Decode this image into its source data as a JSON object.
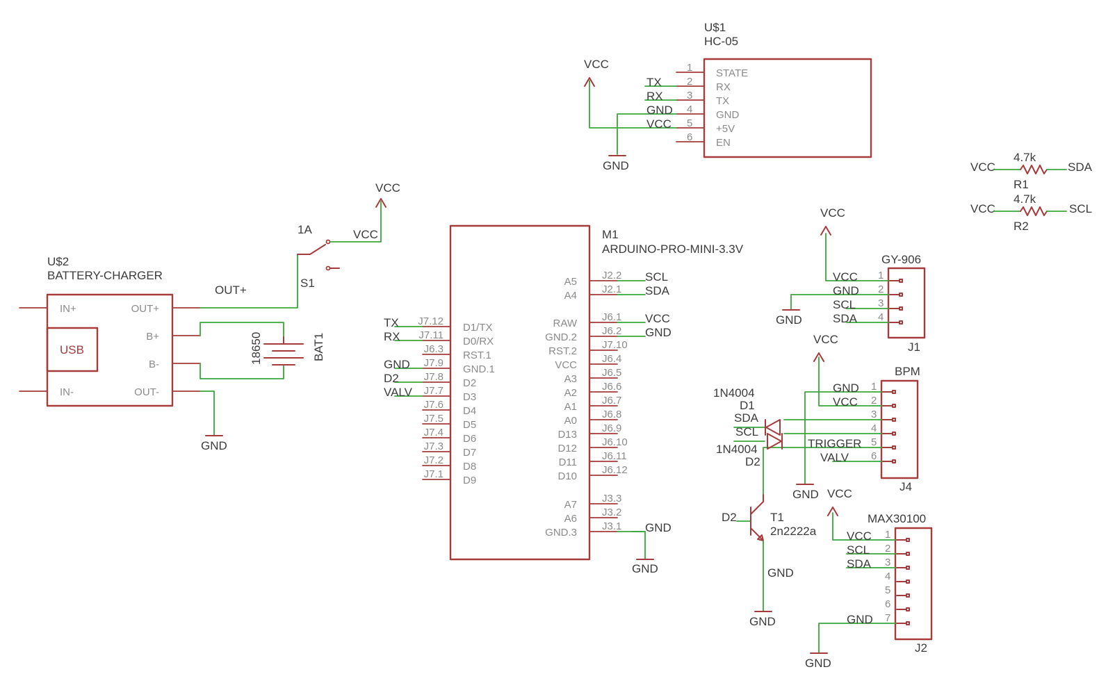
{
  "hc05": {
    "name": "U$1",
    "value": "HC-05",
    "pin_numbers": [
      "1",
      "2",
      "3",
      "4",
      "5",
      "6"
    ],
    "pin_names": [
      "STATE",
      "RX",
      "TX",
      "GND",
      "+5V",
      "EN"
    ],
    "nets": [
      "TX",
      "RX",
      "GND",
      "VCC"
    ],
    "supply_vcc": "VCC",
    "gnd": "GND"
  },
  "charger": {
    "name": "U$2",
    "value": "BATTERY-CHARGER",
    "pins": [
      "IN+",
      "IN-",
      "OUT+",
      "B+",
      "B-",
      "OUT-"
    ],
    "usb_label": "USB",
    "out_net": "OUT+",
    "gnd": "GND"
  },
  "battery": {
    "name": "BAT1",
    "value": "18650"
  },
  "switch": {
    "name": "S1",
    "value": "1A",
    "net": "VCC",
    "supply": "VCC"
  },
  "arduino": {
    "name": "M1",
    "value": "ARDUINO-PRO-MINI-3.3V",
    "left_pins": [
      {
        "pad": "J7.12",
        "name": "D1/TX",
        "net": "TX"
      },
      {
        "pad": "J7.11",
        "name": "D0/RX",
        "net": "RX"
      },
      {
        "pad": "J6.3",
        "name": "RST.1",
        "net": ""
      },
      {
        "pad": "J7.9",
        "name": "GND.1",
        "net": "GND"
      },
      {
        "pad": "J7.8",
        "name": "D2",
        "net": "D2"
      },
      {
        "pad": "J7.7",
        "name": "D3",
        "net": "VALV"
      },
      {
        "pad": "J7.6",
        "name": "D4",
        "net": ""
      },
      {
        "pad": "J7.5",
        "name": "D5",
        "net": ""
      },
      {
        "pad": "J7.4",
        "name": "D6",
        "net": ""
      },
      {
        "pad": "J7.3",
        "name": "D7",
        "net": ""
      },
      {
        "pad": "J7.2",
        "name": "D8",
        "net": ""
      },
      {
        "pad": "J7.1",
        "name": "D9",
        "net": ""
      }
    ],
    "right_pins_top": [
      {
        "pad": "J2.2",
        "name": "A5",
        "net": "SCL"
      },
      {
        "pad": "J2.1",
        "name": "A4",
        "net": "SDA"
      }
    ],
    "right_pins_mid": [
      {
        "pad": "J6.1",
        "name": "RAW",
        "net": "VCC"
      },
      {
        "pad": "J6.2",
        "name": "GND.2",
        "net": "GND"
      },
      {
        "pad": "J7.10",
        "name": "RST.2",
        "net": ""
      },
      {
        "pad": "J6.4",
        "name": "VCC",
        "net": ""
      },
      {
        "pad": "J6.5",
        "name": "A3",
        "net": ""
      },
      {
        "pad": "J6.6",
        "name": "A2",
        "net": ""
      },
      {
        "pad": "J6.7",
        "name": "A1",
        "net": ""
      },
      {
        "pad": "J6.8",
        "name": "A0",
        "net": ""
      },
      {
        "pad": "J6.9",
        "name": "D13",
        "net": ""
      },
      {
        "pad": "J6.10",
        "name": "D12",
        "net": ""
      },
      {
        "pad": "J6.11",
        "name": "D11",
        "net": ""
      },
      {
        "pad": "J6.12",
        "name": "D10",
        "net": ""
      }
    ],
    "right_pins_bottom": [
      {
        "pad": "J3.3",
        "name": "A7",
        "net": ""
      },
      {
        "pad": "J3.2",
        "name": "A6",
        "net": ""
      },
      {
        "pad": "J3.1",
        "name": "GND.3",
        "net": "GND"
      }
    ],
    "gnd": "GND"
  },
  "resistors": [
    {
      "name": "R1",
      "value": "4.7k",
      "left": "VCC",
      "right": "SDA"
    },
    {
      "name": "R2",
      "value": "4.7k",
      "left": "VCC",
      "right": "SCL"
    }
  ],
  "gy906": {
    "value": "GY-906",
    "name": "J1",
    "pin_numbers": [
      "1",
      "2",
      "3",
      "4"
    ],
    "nets": [
      "VCC",
      "GND",
      "SCL",
      "SDA"
    ],
    "supply": "VCC",
    "gnd": "GND"
  },
  "bpm": {
    "value": "BPM",
    "name": "J4",
    "pin_numbers": [
      "1",
      "2",
      "3",
      "4",
      "5",
      "6"
    ],
    "nets": [
      "GND",
      "VCC",
      "",
      "",
      "TRIGGER",
      "VALV"
    ],
    "supply": "VCC",
    "gnd": "GND"
  },
  "diodes": [
    {
      "value": "1N4004",
      "name": "D1",
      "net": "SDA"
    },
    {
      "value": "1N4004",
      "name": "D2",
      "net": "SCL"
    }
  ],
  "transistor": {
    "name": "T1",
    "value": "2n2222a",
    "base_net": "D2",
    "emitter_net": "GND",
    "gnd": "GND"
  },
  "max30100": {
    "value": "MAX30100",
    "name": "J2",
    "pin_numbers": [
      "1",
      "2",
      "3",
      "4",
      "5",
      "6",
      "7"
    ],
    "nets": [
      "VCC",
      "SCL",
      "SDA",
      "",
      "",
      "",
      "GND"
    ],
    "supply": "VCC",
    "gnd": "GND"
  }
}
